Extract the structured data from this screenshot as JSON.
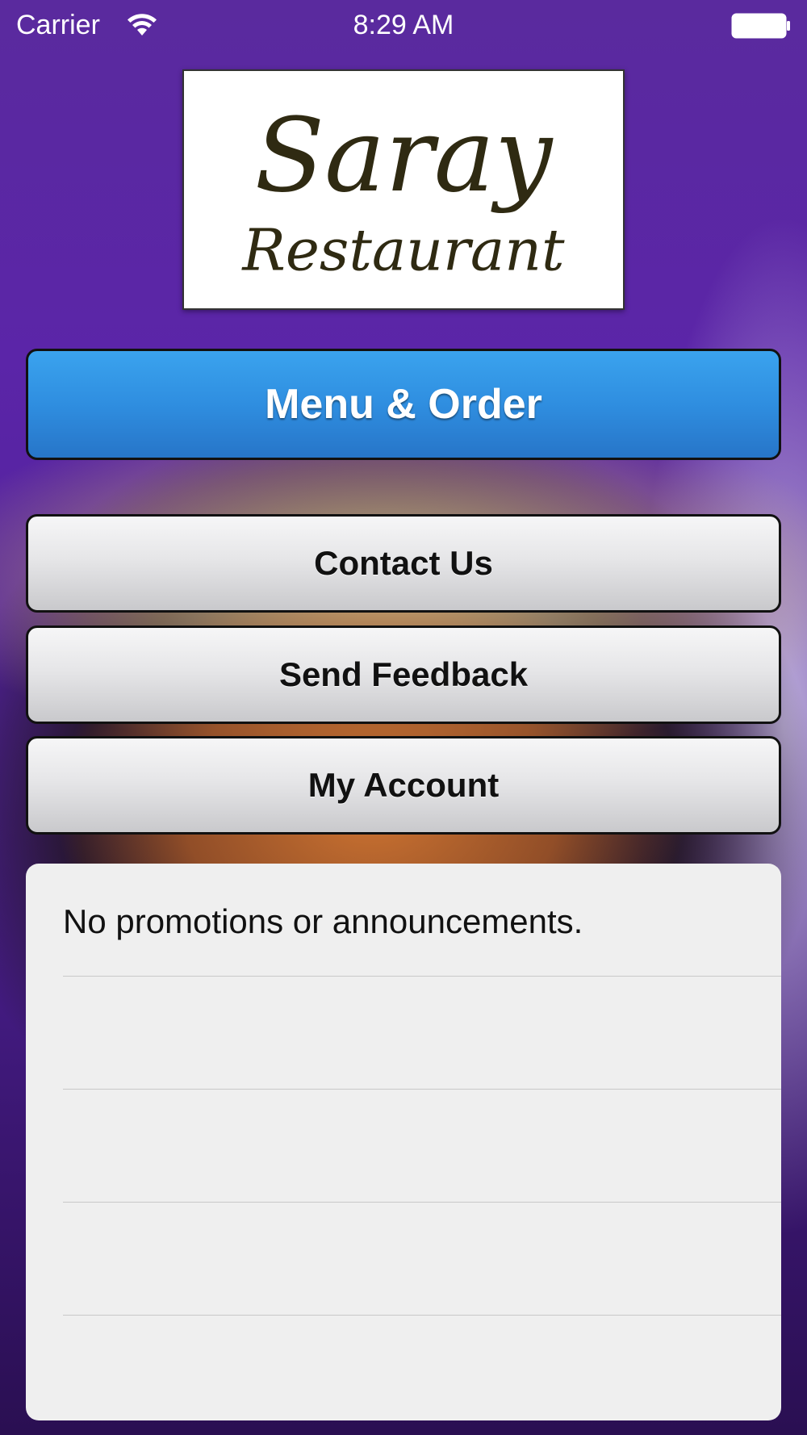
{
  "status_bar": {
    "carrier": "Carrier",
    "time": "8:29 AM",
    "wifi_icon": "wifi-icon",
    "battery_icon": "battery-icon"
  },
  "logo": {
    "line1": "Saray",
    "line2": "Restaurant",
    "color": "#2f2a12"
  },
  "buttons": {
    "menu_order": "Menu & Order",
    "contact_us": "Contact Us",
    "send_feedback": "Send Feedback",
    "my_account": "My Account"
  },
  "promotions": {
    "rows": [
      "No promotions or announcements.",
      "",
      "",
      ""
    ]
  },
  "colors": {
    "primary_button": "#2f8ee0",
    "secondary_button": "#e6e6e8",
    "panel_background": "#efefef",
    "background_purple": "#5b25a8"
  }
}
